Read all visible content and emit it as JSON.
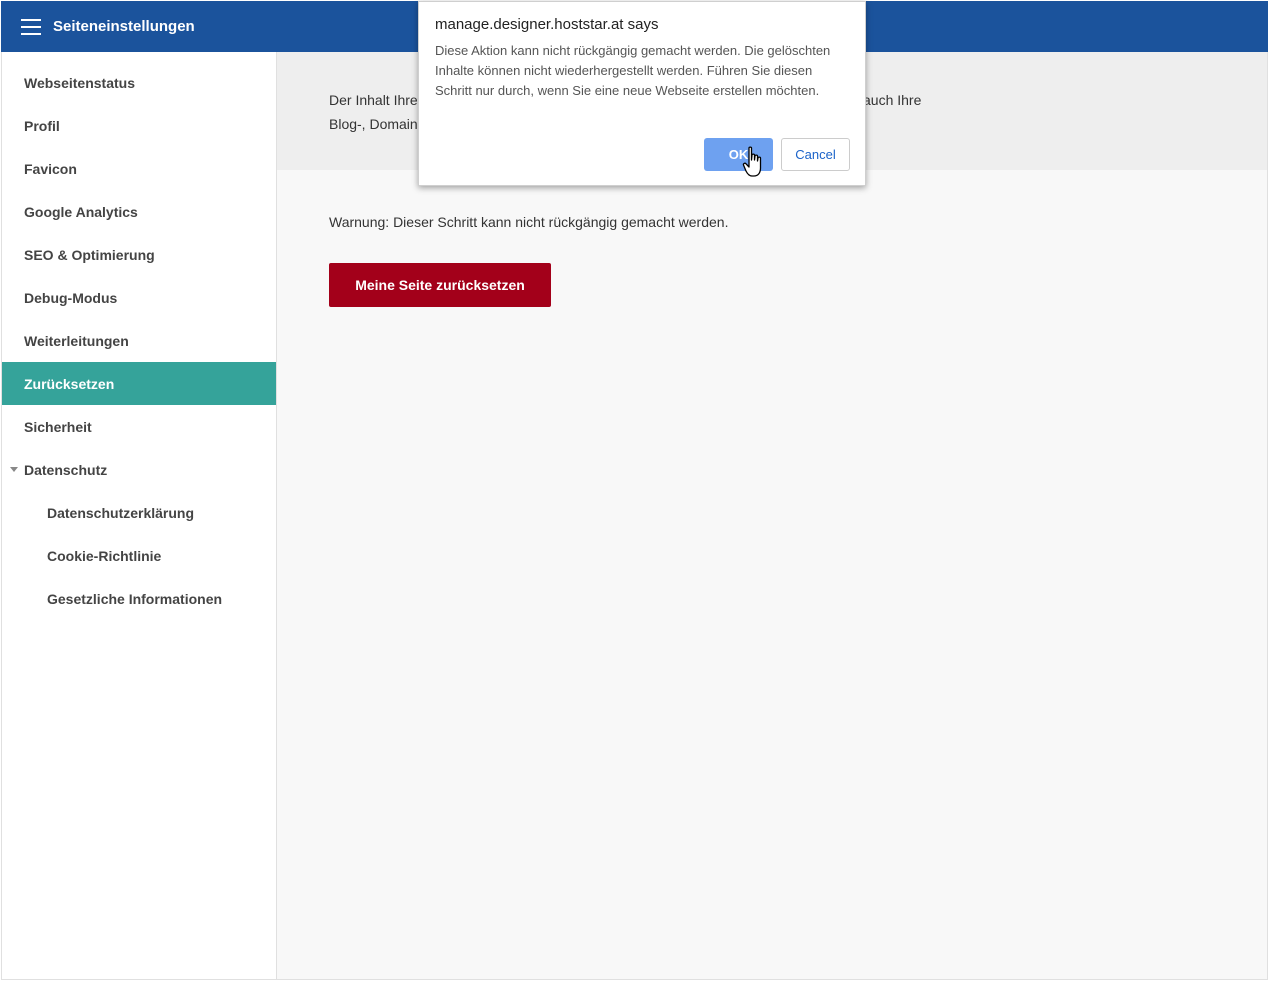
{
  "header": {
    "title": "Seiteneinstellungen",
    "menu_icon": "hamburger-icon",
    "background": "#1b539c"
  },
  "sidebar": {
    "items": [
      {
        "label": "Webseitenstatus"
      },
      {
        "label": "Profil"
      },
      {
        "label": "Favicon"
      },
      {
        "label": "Google Analytics"
      },
      {
        "label": "SEO & Optimierung"
      },
      {
        "label": "Debug-Modus"
      },
      {
        "label": "Weiterleitungen"
      },
      {
        "label": "Zurücksetzen",
        "active": true
      },
      {
        "label": "Sicherheit"
      },
      {
        "label": "Datenschutz",
        "expanded": true
      },
      {
        "label": "Datenschutzerklärung",
        "sub": true
      },
      {
        "label": "Cookie-Richtlinie",
        "sub": true
      },
      {
        "label": "Gesetzliche Informationen",
        "sub": true
      }
    ],
    "active_color": "#35a39a"
  },
  "main": {
    "intro_line1": "Der Inhalt Ihrer",
    "intro_line2": "Blog-, Domain-",
    "intro_tail": "auch Ihre",
    "warning": "Warnung: Dieser Schritt kann nicht rückgängig gemacht werden.",
    "reset_button": "Meine Seite zurücksetzen",
    "reset_color": "#a3001a"
  },
  "dialog": {
    "title": "manage.designer.hoststar.at says",
    "message": "Diese Aktion kann nicht rückgängig gemacht werden. Die gelöschten Inhalte können nicht wiederhergestellt werden. Führen Sie diesen Schritt nur durch, wenn Sie eine neue Webseite erstellen möchten.",
    "ok": "OK",
    "cancel": "Cancel"
  }
}
